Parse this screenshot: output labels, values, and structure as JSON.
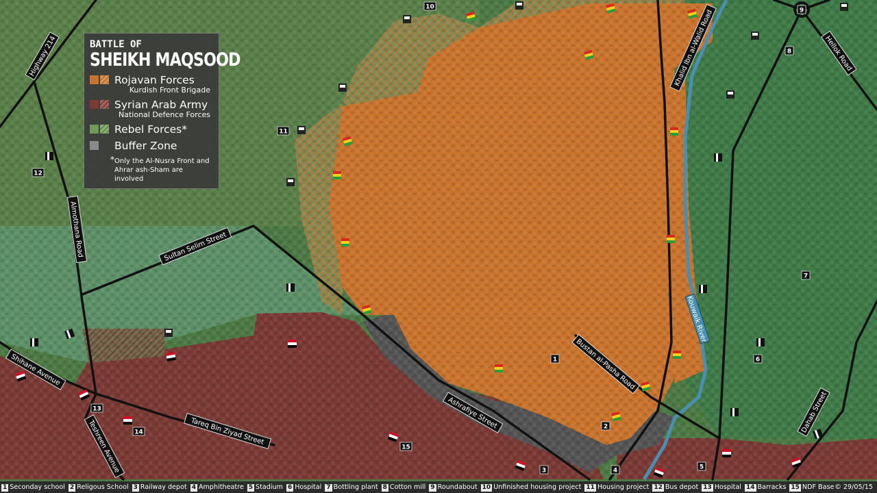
{
  "legend": {
    "kicker": "BATTLE OF",
    "title": "SHEIKH MAQSOOD",
    "items": [
      {
        "label": "Rojavan Forces",
        "sub": "Kurdish Front Brigade",
        "color": "#c8732e"
      },
      {
        "label": "Syrian Arab Army",
        "sub": "National Defence Forces",
        "color": "#7a3a35"
      },
      {
        "label": "Rebel Forces*",
        "sub": "",
        "color": "#5d8a4e"
      },
      {
        "label": "Buffer Zone",
        "sub": "",
        "color": "#7a7a7a"
      }
    ],
    "note_star": "*",
    "note": "Only the Al-Nusra Front and Ahrar ash-Sham are involved"
  },
  "roads": {
    "highway214": "Highway 214",
    "almothana": "Almothana Road",
    "sultan_selim": "Sultan Selim Street",
    "shihane": "Shihane Avenue",
    "tareq": "Tareq Bin Ziyad Street",
    "teshreen": "Teshreen Avenue",
    "ashrafiye": "Ashrafiye Street",
    "bustan": "Bustan al-Pasha Road",
    "khalid": "Khalid Ibn al-Walid Road",
    "hellok": "Hellok Road",
    "dahab": "Dahab Street",
    "river": "Kouwaik River"
  },
  "markers": [
    "1",
    "2",
    "3",
    "4",
    "5",
    "6",
    "7",
    "8",
    "9",
    "10",
    "11",
    "12",
    "13",
    "14"
  ],
  "bottom": {
    "items": [
      {
        "num": "1",
        "label": "Seconday school"
      },
      {
        "num": "2",
        "label": "Religous School"
      },
      {
        "num": "3",
        "label": "Railway depot"
      },
      {
        "num": "4",
        "label": "Amphitheatre"
      },
      {
        "num": "5",
        "label": "Stadium"
      },
      {
        "num": "6",
        "label": "Hospital"
      },
      {
        "num": "7",
        "label": "Bottling plant"
      },
      {
        "num": "8",
        "label": "Cotton mill"
      },
      {
        "num": "9",
        "label": "Roundabout"
      },
      {
        "num": "10",
        "label": "Unfinished housing project"
      },
      {
        "num": "11",
        "label": "Housing project"
      },
      {
        "num": "12",
        "label": "Bus depot"
      },
      {
        "num": "13",
        "label": "Hospital"
      },
      {
        "num": "14",
        "label": "Barracks"
      },
      {
        "num": "15",
        "label": "NDF Base"
      }
    ],
    "date": "© 29/05/15"
  },
  "colors": {
    "kurdish": "#c8732e",
    "regime": "#7a3a35",
    "rebel": "#5d8a4e",
    "buffer": "#555555",
    "road": "#111111",
    "river": "#4a8fb0"
  }
}
